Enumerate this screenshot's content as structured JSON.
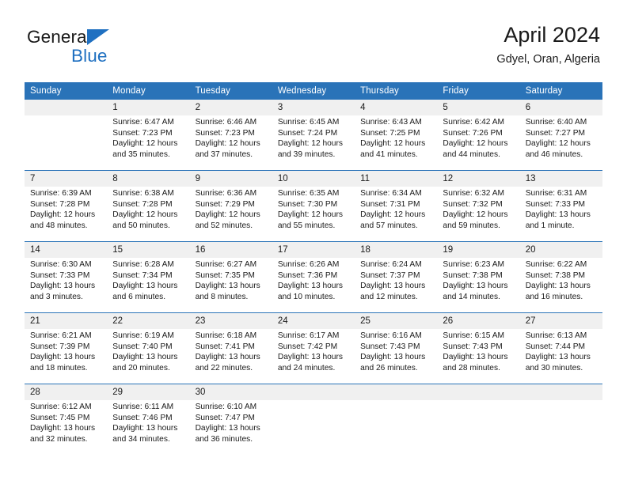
{
  "brand": {
    "name_top": "General",
    "name_bottom": "Blue",
    "flag_color": "#1f70c1"
  },
  "header": {
    "title": "April 2024",
    "subtitle": "Gdyel, Oran, Algeria",
    "header_bg": "#2a73b8",
    "daynum_bg": "#f0f0f0"
  },
  "weekday_headers": [
    "Sunday",
    "Monday",
    "Tuesday",
    "Wednesday",
    "Thursday",
    "Friday",
    "Saturday"
  ],
  "labels": {
    "sunrise": "Sunrise:",
    "sunset": "Sunset:",
    "daylight": "Daylight:"
  },
  "weeks": [
    [
      {
        "day": "",
        "blank": true,
        "sunrise": "",
        "sunset": "",
        "daylight_1": "",
        "daylight_2": ""
      },
      {
        "day": "1",
        "sunrise": "Sunrise: 6:47 AM",
        "sunset": "Sunset: 7:23 PM",
        "daylight_1": "Daylight: 12 hours",
        "daylight_2": "and 35 minutes."
      },
      {
        "day": "2",
        "sunrise": "Sunrise: 6:46 AM",
        "sunset": "Sunset: 7:23 PM",
        "daylight_1": "Daylight: 12 hours",
        "daylight_2": "and 37 minutes."
      },
      {
        "day": "3",
        "sunrise": "Sunrise: 6:45 AM",
        "sunset": "Sunset: 7:24 PM",
        "daylight_1": "Daylight: 12 hours",
        "daylight_2": "and 39 minutes."
      },
      {
        "day": "4",
        "sunrise": "Sunrise: 6:43 AM",
        "sunset": "Sunset: 7:25 PM",
        "daylight_1": "Daylight: 12 hours",
        "daylight_2": "and 41 minutes."
      },
      {
        "day": "5",
        "sunrise": "Sunrise: 6:42 AM",
        "sunset": "Sunset: 7:26 PM",
        "daylight_1": "Daylight: 12 hours",
        "daylight_2": "and 44 minutes."
      },
      {
        "day": "6",
        "sunrise": "Sunrise: 6:40 AM",
        "sunset": "Sunset: 7:27 PM",
        "daylight_1": "Daylight: 12 hours",
        "daylight_2": "and 46 minutes."
      }
    ],
    [
      {
        "day": "7",
        "sunrise": "Sunrise: 6:39 AM",
        "sunset": "Sunset: 7:28 PM",
        "daylight_1": "Daylight: 12 hours",
        "daylight_2": "and 48 minutes."
      },
      {
        "day": "8",
        "sunrise": "Sunrise: 6:38 AM",
        "sunset": "Sunset: 7:28 PM",
        "daylight_1": "Daylight: 12 hours",
        "daylight_2": "and 50 minutes."
      },
      {
        "day": "9",
        "sunrise": "Sunrise: 6:36 AM",
        "sunset": "Sunset: 7:29 PM",
        "daylight_1": "Daylight: 12 hours",
        "daylight_2": "and 52 minutes."
      },
      {
        "day": "10",
        "sunrise": "Sunrise: 6:35 AM",
        "sunset": "Sunset: 7:30 PM",
        "daylight_1": "Daylight: 12 hours",
        "daylight_2": "and 55 minutes."
      },
      {
        "day": "11",
        "sunrise": "Sunrise: 6:34 AM",
        "sunset": "Sunset: 7:31 PM",
        "daylight_1": "Daylight: 12 hours",
        "daylight_2": "and 57 minutes."
      },
      {
        "day": "12",
        "sunrise": "Sunrise: 6:32 AM",
        "sunset": "Sunset: 7:32 PM",
        "daylight_1": "Daylight: 12 hours",
        "daylight_2": "and 59 minutes."
      },
      {
        "day": "13",
        "sunrise": "Sunrise: 6:31 AM",
        "sunset": "Sunset: 7:33 PM",
        "daylight_1": "Daylight: 13 hours",
        "daylight_2": "and 1 minute."
      }
    ],
    [
      {
        "day": "14",
        "sunrise": "Sunrise: 6:30 AM",
        "sunset": "Sunset: 7:33 PM",
        "daylight_1": "Daylight: 13 hours",
        "daylight_2": "and 3 minutes."
      },
      {
        "day": "15",
        "sunrise": "Sunrise: 6:28 AM",
        "sunset": "Sunset: 7:34 PM",
        "daylight_1": "Daylight: 13 hours",
        "daylight_2": "and 6 minutes."
      },
      {
        "day": "16",
        "sunrise": "Sunrise: 6:27 AM",
        "sunset": "Sunset: 7:35 PM",
        "daylight_1": "Daylight: 13 hours",
        "daylight_2": "and 8 minutes."
      },
      {
        "day": "17",
        "sunrise": "Sunrise: 6:26 AM",
        "sunset": "Sunset: 7:36 PM",
        "daylight_1": "Daylight: 13 hours",
        "daylight_2": "and 10 minutes."
      },
      {
        "day": "18",
        "sunrise": "Sunrise: 6:24 AM",
        "sunset": "Sunset: 7:37 PM",
        "daylight_1": "Daylight: 13 hours",
        "daylight_2": "and 12 minutes."
      },
      {
        "day": "19",
        "sunrise": "Sunrise: 6:23 AM",
        "sunset": "Sunset: 7:38 PM",
        "daylight_1": "Daylight: 13 hours",
        "daylight_2": "and 14 minutes."
      },
      {
        "day": "20",
        "sunrise": "Sunrise: 6:22 AM",
        "sunset": "Sunset: 7:38 PM",
        "daylight_1": "Daylight: 13 hours",
        "daylight_2": "and 16 minutes."
      }
    ],
    [
      {
        "day": "21",
        "sunrise": "Sunrise: 6:21 AM",
        "sunset": "Sunset: 7:39 PM",
        "daylight_1": "Daylight: 13 hours",
        "daylight_2": "and 18 minutes."
      },
      {
        "day": "22",
        "sunrise": "Sunrise: 6:19 AM",
        "sunset": "Sunset: 7:40 PM",
        "daylight_1": "Daylight: 13 hours",
        "daylight_2": "and 20 minutes."
      },
      {
        "day": "23",
        "sunrise": "Sunrise: 6:18 AM",
        "sunset": "Sunset: 7:41 PM",
        "daylight_1": "Daylight: 13 hours",
        "daylight_2": "and 22 minutes."
      },
      {
        "day": "24",
        "sunrise": "Sunrise: 6:17 AM",
        "sunset": "Sunset: 7:42 PM",
        "daylight_1": "Daylight: 13 hours",
        "daylight_2": "and 24 minutes."
      },
      {
        "day": "25",
        "sunrise": "Sunrise: 6:16 AM",
        "sunset": "Sunset: 7:43 PM",
        "daylight_1": "Daylight: 13 hours",
        "daylight_2": "and 26 minutes."
      },
      {
        "day": "26",
        "sunrise": "Sunrise: 6:15 AM",
        "sunset": "Sunset: 7:43 PM",
        "daylight_1": "Daylight: 13 hours",
        "daylight_2": "and 28 minutes."
      },
      {
        "day": "27",
        "sunrise": "Sunrise: 6:13 AM",
        "sunset": "Sunset: 7:44 PM",
        "daylight_1": "Daylight: 13 hours",
        "daylight_2": "and 30 minutes."
      }
    ],
    [
      {
        "day": "28",
        "sunrise": "Sunrise: 6:12 AM",
        "sunset": "Sunset: 7:45 PM",
        "daylight_1": "Daylight: 13 hours",
        "daylight_2": "and 32 minutes."
      },
      {
        "day": "29",
        "sunrise": "Sunrise: 6:11 AM",
        "sunset": "Sunset: 7:46 PM",
        "daylight_1": "Daylight: 13 hours",
        "daylight_2": "and 34 minutes."
      },
      {
        "day": "30",
        "sunrise": "Sunrise: 6:10 AM",
        "sunset": "Sunset: 7:47 PM",
        "daylight_1": "Daylight: 13 hours",
        "daylight_2": "and 36 minutes."
      },
      {
        "day": "",
        "blank": true,
        "sunrise": "",
        "sunset": "",
        "daylight_1": "",
        "daylight_2": ""
      },
      {
        "day": "",
        "blank": true,
        "sunrise": "",
        "sunset": "",
        "daylight_1": "",
        "daylight_2": ""
      },
      {
        "day": "",
        "blank": true,
        "sunrise": "",
        "sunset": "",
        "daylight_1": "",
        "daylight_2": ""
      },
      {
        "day": "",
        "blank": true,
        "sunrise": "",
        "sunset": "",
        "daylight_1": "",
        "daylight_2": ""
      }
    ]
  ]
}
